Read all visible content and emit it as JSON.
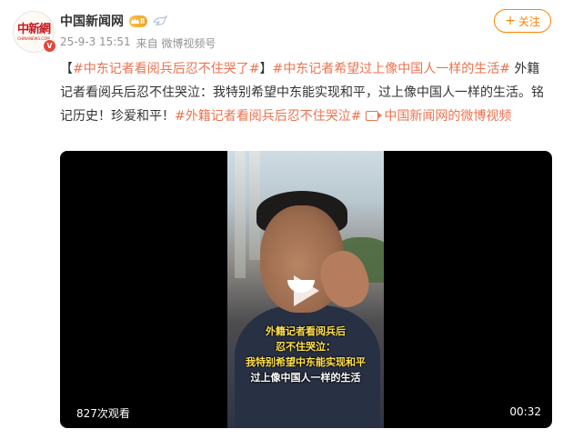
{
  "account": {
    "name": "中国新闻网",
    "avatar_logo": "中新網",
    "avatar_subtext": "CHINANEWS.COM",
    "verified_mark": "V",
    "member_badge": "Ⅱ",
    "icons": [
      "avatar-logo",
      "verified-badge-icon",
      "crown-badge-icon",
      "dove-icon"
    ]
  },
  "meta": {
    "time": "25-9-3 15:51",
    "source": "来自 微博视频号"
  },
  "follow_button": {
    "label": "关注",
    "icon": "+"
  },
  "post": {
    "bracket_open": "【",
    "tag1": "#中东记者看阅兵后忍不住哭了#",
    "bracket_close": "】",
    "tag2": "#中东记者希望过上像中国人一样的生活#",
    "body": " 外籍记者看阅兵后忍不住哭泣：我特别希望中东能实现和平，过上像中国人一样的生活。铭记历史！珍爱和平！",
    "tag3": "#外籍记者看阅兵后忍不住哭泣#",
    "video_link": "中国新闻网的微博视频"
  },
  "video": {
    "caption_line1": "外籍记者看阅兵后",
    "caption_line2": "忍不住哭泣：",
    "caption_line3": "我特别希望中东能实现和平",
    "caption_line4": "过上像中国人一样的生活",
    "views": "827次观看",
    "duration": "00:32"
  },
  "colors": {
    "accent_orange": "#ff8200",
    "tag_color": "#eb7350",
    "meta_gray": "#939393",
    "brand_red": "#c8161d"
  }
}
